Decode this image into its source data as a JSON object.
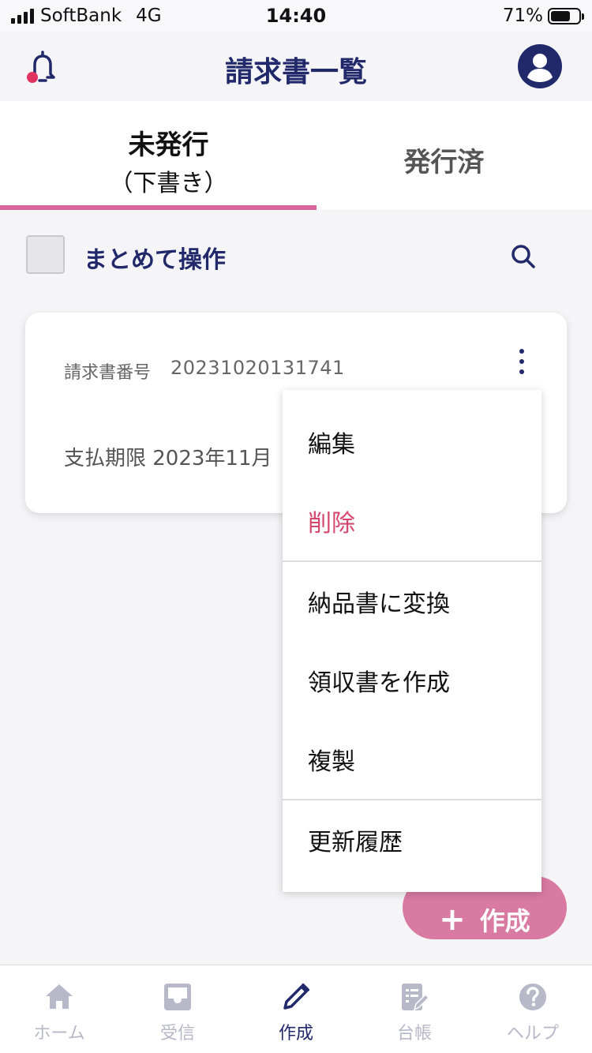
{
  "status_bar": {
    "carrier": "SoftBank",
    "network": "4G",
    "time": "14:40",
    "battery_percent": "71%",
    "battery_level": 0.71
  },
  "header": {
    "title": "請求書一覧",
    "left_icon": "bell-icon",
    "right_icon": "account-icon"
  },
  "tabs": [
    {
      "label": "未発行",
      "sublabel": "（下書き）",
      "active": true
    },
    {
      "label": "発行済",
      "active": false
    }
  ],
  "bulk": {
    "label": "まとめて操作",
    "checked": false
  },
  "invoice_card": {
    "number_label": "請求書番号",
    "number": "20231020131741",
    "due_text": "支払期限 2023年11月"
  },
  "context_menu": {
    "items": [
      {
        "label": "編集"
      },
      {
        "label": "削除",
        "danger": true
      },
      {
        "label": "納品書に変換"
      },
      {
        "label": "領収書を作成"
      },
      {
        "label": "複製"
      },
      {
        "label": "更新履歴"
      }
    ]
  },
  "fab": {
    "icon": "plus-icon",
    "label": "作成"
  },
  "bottom_nav": {
    "items": [
      {
        "label": "ホーム",
        "icon": "home-icon",
        "active": false
      },
      {
        "label": "受信",
        "icon": "inbox-icon",
        "active": false
      },
      {
        "label": "作成",
        "icon": "pencil-icon",
        "active": true
      },
      {
        "label": "台帳",
        "icon": "ledger-icon",
        "active": false
      },
      {
        "label": "ヘルプ",
        "icon": "help-icon",
        "active": false
      }
    ]
  },
  "colors": {
    "navy": "#22296b",
    "pink": "#d8679b",
    "danger": "#d6476d",
    "inactive": "#b7b8c8"
  }
}
